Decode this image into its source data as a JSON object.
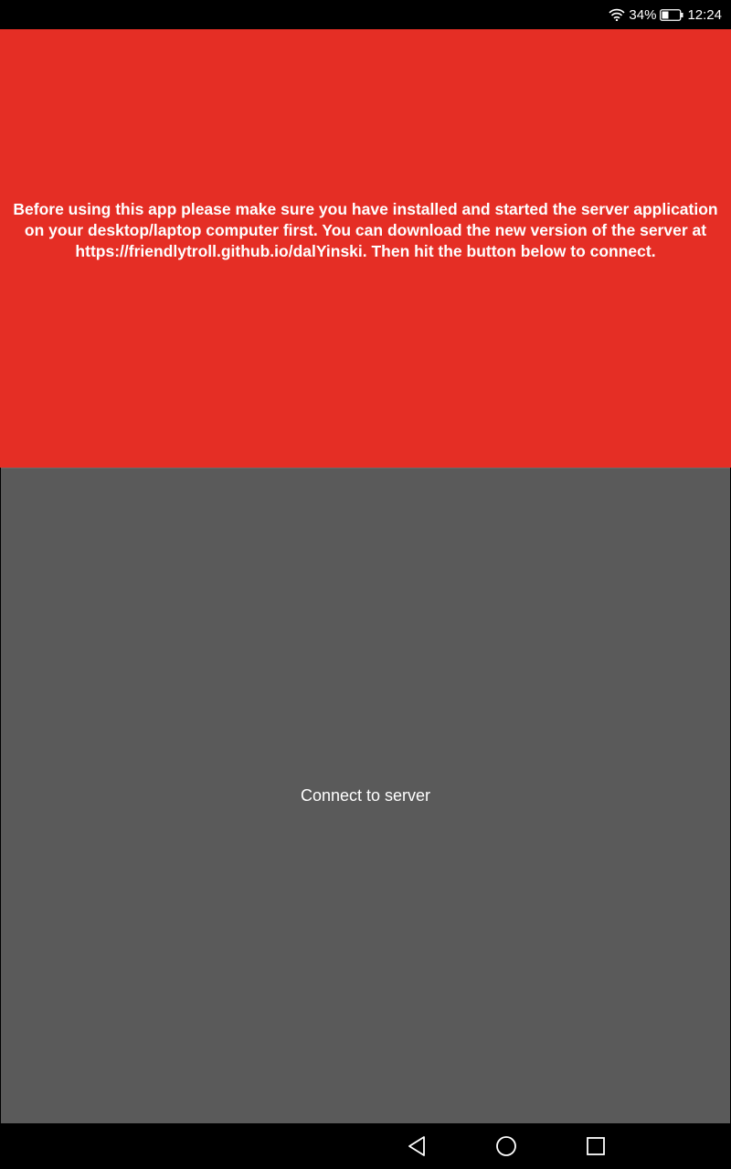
{
  "status_bar": {
    "battery_percent": "34%",
    "time": "12:24",
    "icons": [
      "wifi-icon",
      "battery-icon"
    ]
  },
  "banner": {
    "message": "Before using this app please make sure you have installed and started the server application on your desktop/laptop computer first. You can download the new version of the server at https://friendlytroll.github.io/dalYinski. Then hit the button below to connect.",
    "background_color": "#e52e25",
    "text_color": "#ffffff"
  },
  "connect": {
    "label": "Connect to server",
    "background_color": "#5a5a5a"
  },
  "nav_bar": {
    "buttons": [
      "back-icon",
      "home-icon",
      "recents-icon"
    ]
  }
}
